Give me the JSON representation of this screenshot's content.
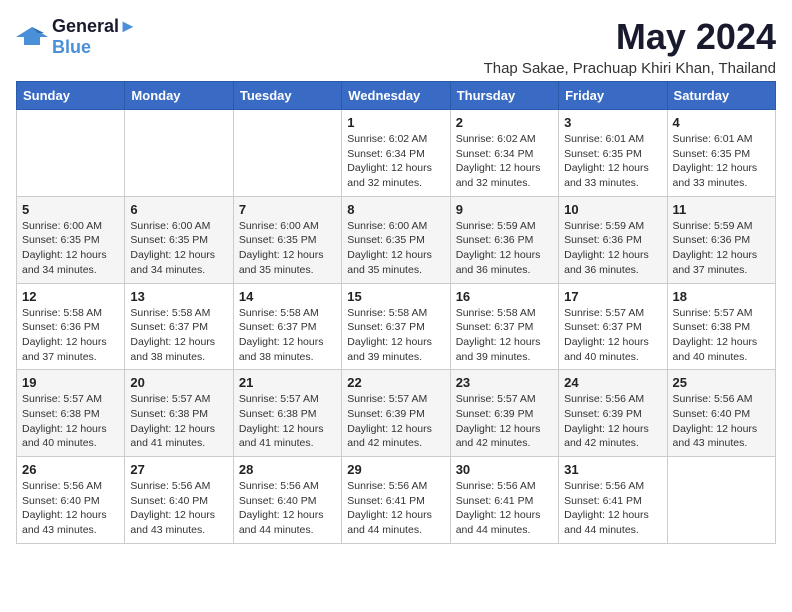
{
  "logo": {
    "line1": "General",
    "line2": "Blue"
  },
  "title": "May 2024",
  "location": "Thap Sakae, Prachuap Khiri Khan, Thailand",
  "weekdays": [
    "Sunday",
    "Monday",
    "Tuesday",
    "Wednesday",
    "Thursday",
    "Friday",
    "Saturday"
  ],
  "weeks": [
    [
      {
        "day": "",
        "info": ""
      },
      {
        "day": "",
        "info": ""
      },
      {
        "day": "",
        "info": ""
      },
      {
        "day": "1",
        "info": "Sunrise: 6:02 AM\nSunset: 6:34 PM\nDaylight: 12 hours\nand 32 minutes."
      },
      {
        "day": "2",
        "info": "Sunrise: 6:02 AM\nSunset: 6:34 PM\nDaylight: 12 hours\nand 32 minutes."
      },
      {
        "day": "3",
        "info": "Sunrise: 6:01 AM\nSunset: 6:35 PM\nDaylight: 12 hours\nand 33 minutes."
      },
      {
        "day": "4",
        "info": "Sunrise: 6:01 AM\nSunset: 6:35 PM\nDaylight: 12 hours\nand 33 minutes."
      }
    ],
    [
      {
        "day": "5",
        "info": "Sunrise: 6:00 AM\nSunset: 6:35 PM\nDaylight: 12 hours\nand 34 minutes."
      },
      {
        "day": "6",
        "info": "Sunrise: 6:00 AM\nSunset: 6:35 PM\nDaylight: 12 hours\nand 34 minutes."
      },
      {
        "day": "7",
        "info": "Sunrise: 6:00 AM\nSunset: 6:35 PM\nDaylight: 12 hours\nand 35 minutes."
      },
      {
        "day": "8",
        "info": "Sunrise: 6:00 AM\nSunset: 6:35 PM\nDaylight: 12 hours\nand 35 minutes."
      },
      {
        "day": "9",
        "info": "Sunrise: 5:59 AM\nSunset: 6:36 PM\nDaylight: 12 hours\nand 36 minutes."
      },
      {
        "day": "10",
        "info": "Sunrise: 5:59 AM\nSunset: 6:36 PM\nDaylight: 12 hours\nand 36 minutes."
      },
      {
        "day": "11",
        "info": "Sunrise: 5:59 AM\nSunset: 6:36 PM\nDaylight: 12 hours\nand 37 minutes."
      }
    ],
    [
      {
        "day": "12",
        "info": "Sunrise: 5:58 AM\nSunset: 6:36 PM\nDaylight: 12 hours\nand 37 minutes."
      },
      {
        "day": "13",
        "info": "Sunrise: 5:58 AM\nSunset: 6:37 PM\nDaylight: 12 hours\nand 38 minutes."
      },
      {
        "day": "14",
        "info": "Sunrise: 5:58 AM\nSunset: 6:37 PM\nDaylight: 12 hours\nand 38 minutes."
      },
      {
        "day": "15",
        "info": "Sunrise: 5:58 AM\nSunset: 6:37 PM\nDaylight: 12 hours\nand 39 minutes."
      },
      {
        "day": "16",
        "info": "Sunrise: 5:58 AM\nSunset: 6:37 PM\nDaylight: 12 hours\nand 39 minutes."
      },
      {
        "day": "17",
        "info": "Sunrise: 5:57 AM\nSunset: 6:37 PM\nDaylight: 12 hours\nand 40 minutes."
      },
      {
        "day": "18",
        "info": "Sunrise: 5:57 AM\nSunset: 6:38 PM\nDaylight: 12 hours\nand 40 minutes."
      }
    ],
    [
      {
        "day": "19",
        "info": "Sunrise: 5:57 AM\nSunset: 6:38 PM\nDaylight: 12 hours\nand 40 minutes."
      },
      {
        "day": "20",
        "info": "Sunrise: 5:57 AM\nSunset: 6:38 PM\nDaylight: 12 hours\nand 41 minutes."
      },
      {
        "day": "21",
        "info": "Sunrise: 5:57 AM\nSunset: 6:38 PM\nDaylight: 12 hours\nand 41 minutes."
      },
      {
        "day": "22",
        "info": "Sunrise: 5:57 AM\nSunset: 6:39 PM\nDaylight: 12 hours\nand 42 minutes."
      },
      {
        "day": "23",
        "info": "Sunrise: 5:57 AM\nSunset: 6:39 PM\nDaylight: 12 hours\nand 42 minutes."
      },
      {
        "day": "24",
        "info": "Sunrise: 5:56 AM\nSunset: 6:39 PM\nDaylight: 12 hours\nand 42 minutes."
      },
      {
        "day": "25",
        "info": "Sunrise: 5:56 AM\nSunset: 6:40 PM\nDaylight: 12 hours\nand 43 minutes."
      }
    ],
    [
      {
        "day": "26",
        "info": "Sunrise: 5:56 AM\nSunset: 6:40 PM\nDaylight: 12 hours\nand 43 minutes."
      },
      {
        "day": "27",
        "info": "Sunrise: 5:56 AM\nSunset: 6:40 PM\nDaylight: 12 hours\nand 43 minutes."
      },
      {
        "day": "28",
        "info": "Sunrise: 5:56 AM\nSunset: 6:40 PM\nDaylight: 12 hours\nand 44 minutes."
      },
      {
        "day": "29",
        "info": "Sunrise: 5:56 AM\nSunset: 6:41 PM\nDaylight: 12 hours\nand 44 minutes."
      },
      {
        "day": "30",
        "info": "Sunrise: 5:56 AM\nSunset: 6:41 PM\nDaylight: 12 hours\nand 44 minutes."
      },
      {
        "day": "31",
        "info": "Sunrise: 5:56 AM\nSunset: 6:41 PM\nDaylight: 12 hours\nand 44 minutes."
      },
      {
        "day": "",
        "info": ""
      }
    ]
  ]
}
